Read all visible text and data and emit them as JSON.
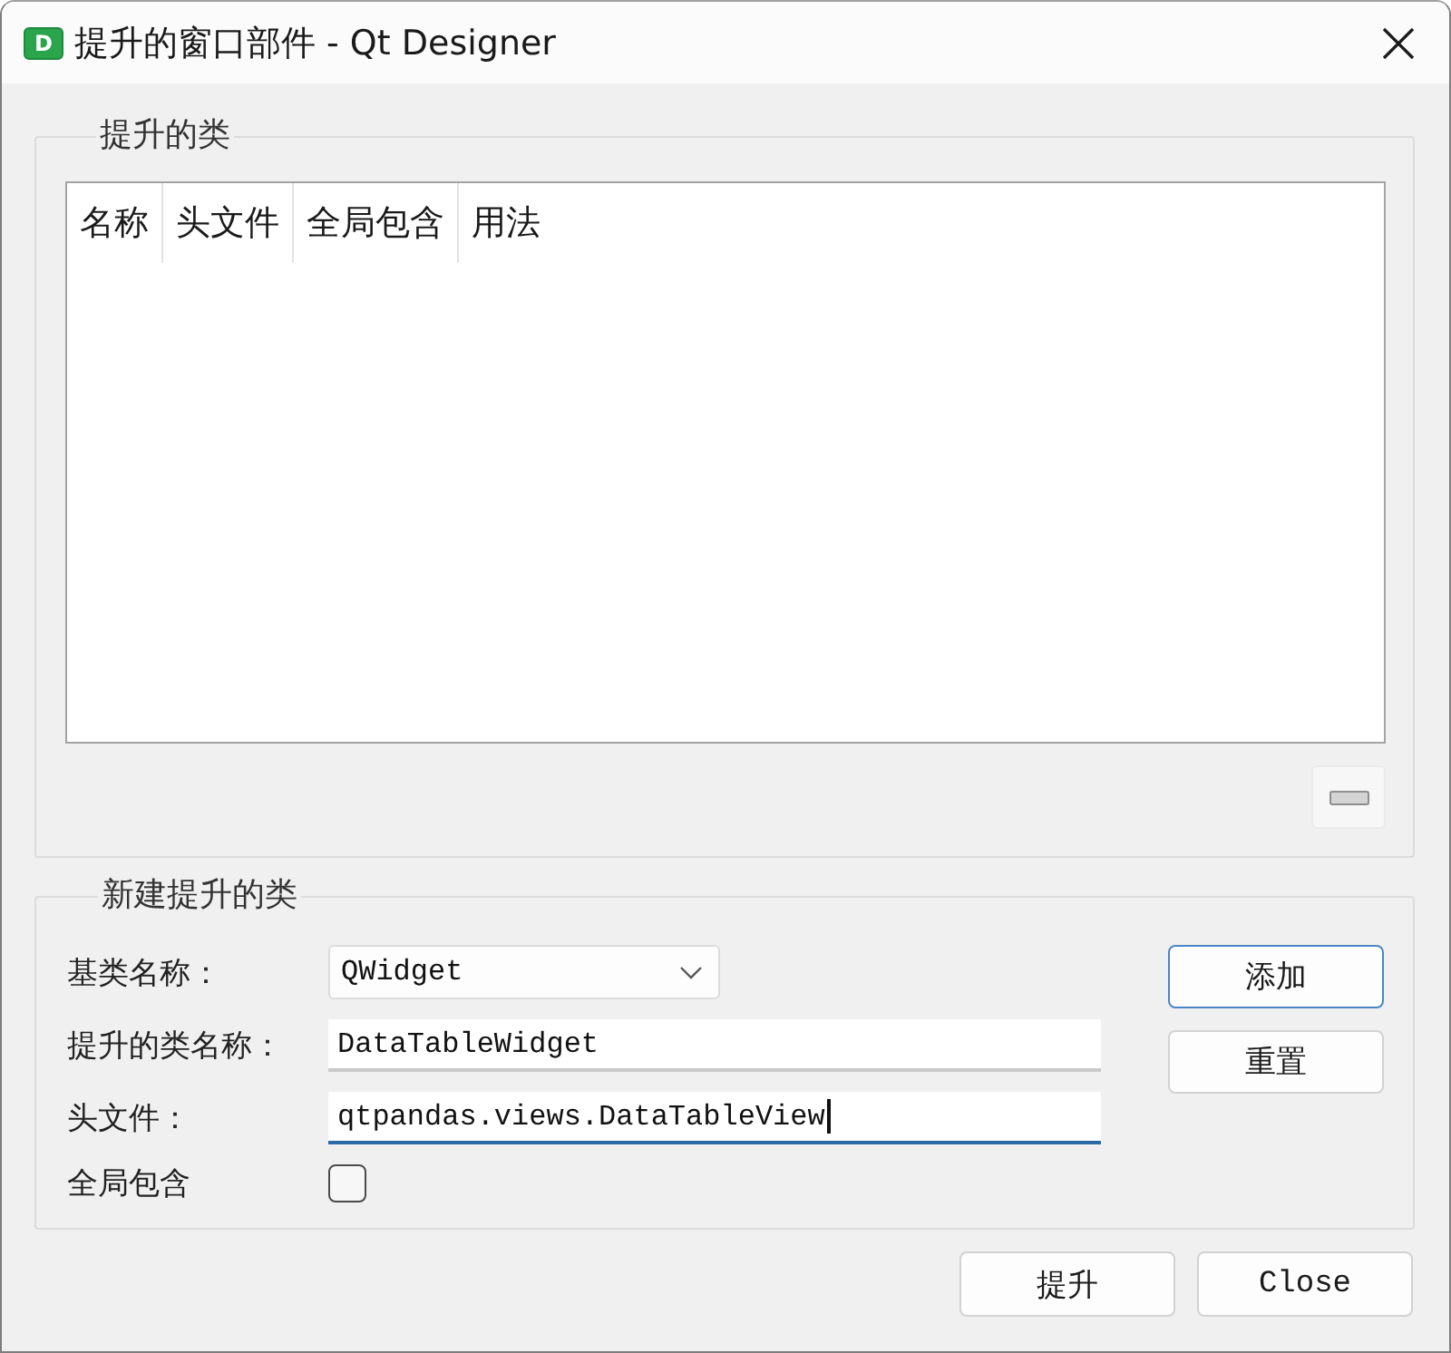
{
  "window": {
    "title": "提升的窗口部件 - Qt Designer",
    "icon_letter": "D"
  },
  "promoted_classes": {
    "title": "提升的类",
    "table": {
      "columns": [
        "名称",
        "头文件",
        "全局包含",
        "用法"
      ]
    }
  },
  "new_promoted_class": {
    "title": "新建提升的类",
    "fields": [
      {
        "kind": "combo",
        "label": "基类名称：",
        "value": "QWidget",
        "focused": false
      },
      {
        "kind": "text",
        "label": "提升的类名称：",
        "value": "DataTableWidget",
        "focused": false
      },
      {
        "kind": "text",
        "label": "头文件：",
        "value": "qtpandas.views.DataTableView",
        "focused": true
      },
      {
        "kind": "checkbox",
        "label": "全局包含",
        "checked": false
      }
    ],
    "buttons": [
      {
        "label": "添加",
        "default": true
      },
      {
        "label": "重置",
        "default": false
      }
    ]
  },
  "buttons": [
    {
      "label": "提升",
      "default": false
    },
    {
      "label": "Close",
      "default": false
    }
  ]
}
